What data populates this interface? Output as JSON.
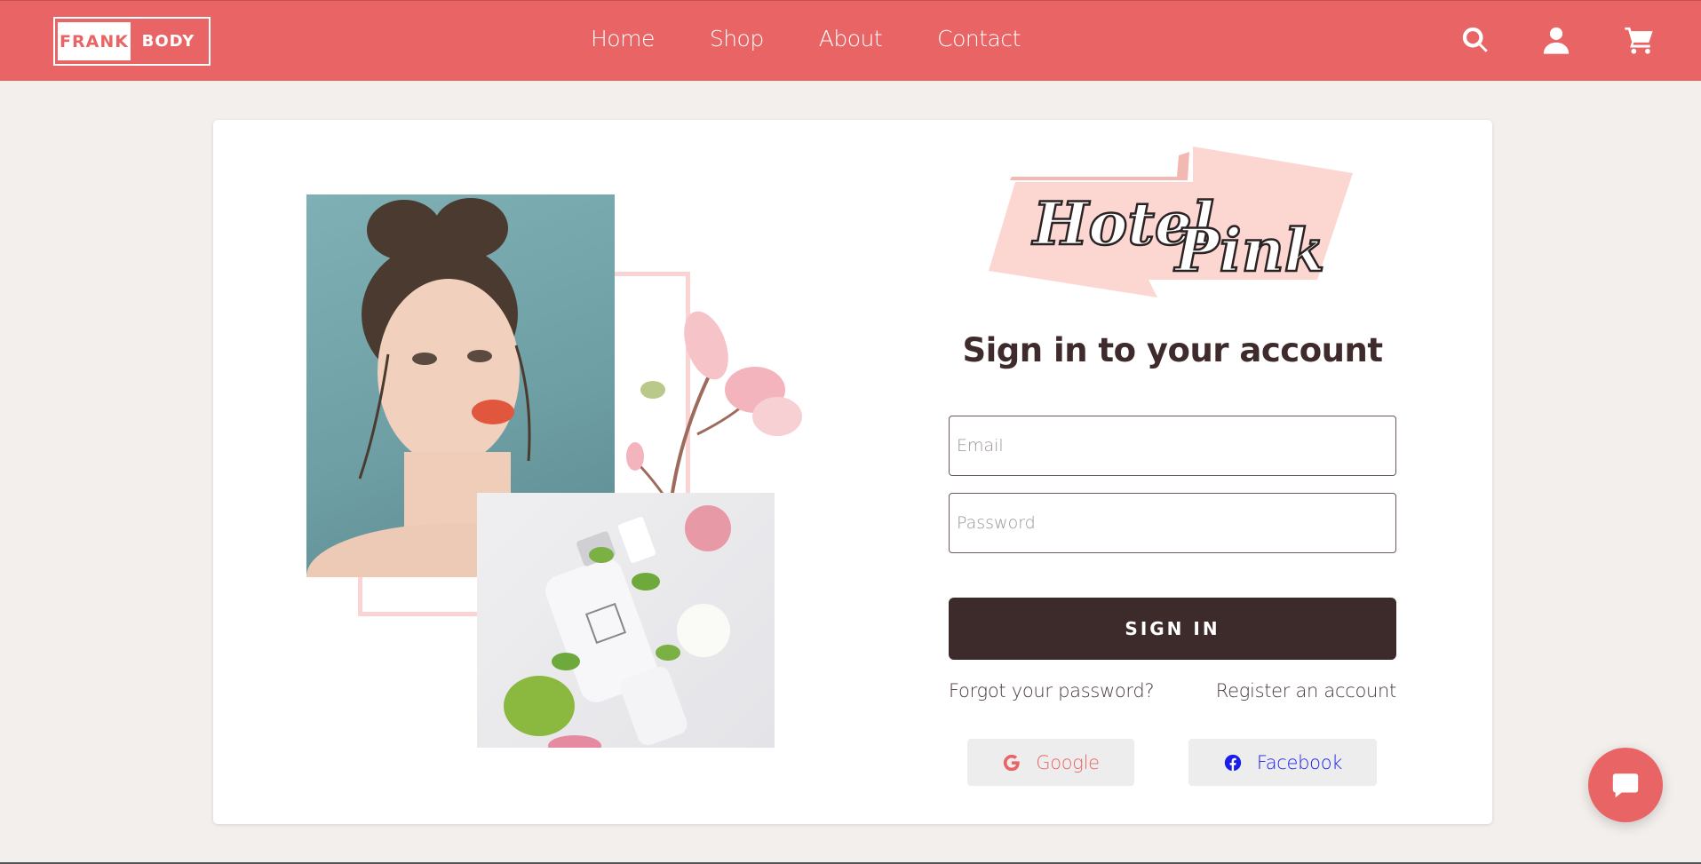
{
  "header": {
    "logo": {
      "left": "FRANK",
      "right": "BODY"
    },
    "nav": [
      "Home",
      "Shop",
      "About",
      "Contact"
    ],
    "icons": [
      "search-icon",
      "user-icon",
      "cart-icon"
    ]
  },
  "brand": {
    "badge_text": "Hotel Pink"
  },
  "form": {
    "title": "Sign in to your account",
    "email_placeholder": "Email",
    "password_placeholder": "Password",
    "signin_label": "SIGN IN",
    "forgot_label": "Forgot your password?",
    "register_label": "Register an account"
  },
  "social": {
    "google_label": "Google",
    "facebook_label": "Facebook"
  },
  "colors": {
    "header": "#e96565",
    "button": "#3d2b2c",
    "background": "#f3efec",
    "google": "#e96565",
    "facebook": "#1a1ee8"
  }
}
